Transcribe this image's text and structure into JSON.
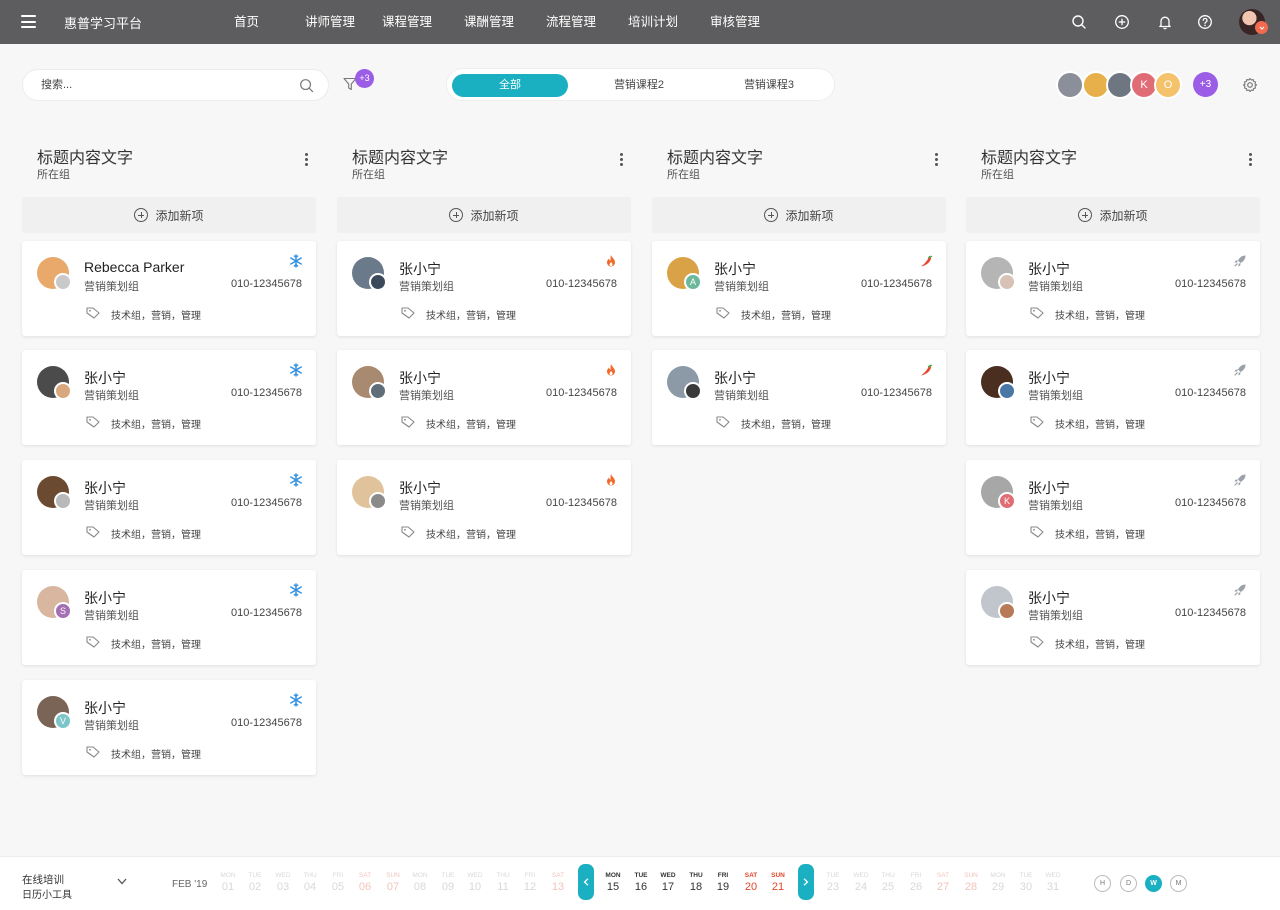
{
  "brand": "惠普学习平台",
  "nav": {
    "tabs": [
      {
        "label": "首页",
        "active": true
      },
      {
        "label": "讲师管理",
        "active": false
      },
      {
        "label": "课程管理",
        "active": false
      },
      {
        "label": "课酬管理",
        "active": false
      },
      {
        "label": "流程管理",
        "active": false
      },
      {
        "label": "培训计划",
        "active": false
      },
      {
        "label": "审核管理",
        "active": false
      }
    ],
    "icons": [
      "search-icon",
      "add-circle-icon",
      "bell-icon",
      "help-icon"
    ]
  },
  "toolbar": {
    "search_placeholder": "搜索...",
    "filter_count": "+3",
    "segments": [
      {
        "label": "全部",
        "active": true
      },
      {
        "label": "营销课程2",
        "active": false
      },
      {
        "label": "营销课程3",
        "active": false
      }
    ],
    "members": [
      {
        "initial": "",
        "color": "#8b8f99"
      },
      {
        "initial": "",
        "color": "#e7b04a"
      },
      {
        "initial": "",
        "color": "#6e7682"
      },
      {
        "initial": "K",
        "color": "#e06c75"
      },
      {
        "initial": "O",
        "color": "#f3c26b"
      }
    ],
    "more_members": "+3"
  },
  "columns": [
    {
      "title": "标题内容文字",
      "subtitle": "所在组",
      "add_label": "添加新项",
      "priority_icon": "snowflake-icon",
      "cards": [
        {
          "name": "Rebecca Parker",
          "group": "营销策划组",
          "phone": "010-12345678",
          "tags": "技术组，营销，管理",
          "initial": "",
          "av_color": "#e8a96b",
          "av2_color": "#c9c9c9"
        },
        {
          "name": "张小宁",
          "group": "营销策划组",
          "phone": "010-12345678",
          "tags": "技术组，营销，管理",
          "initial": "",
          "av_color": "#4b4b4b",
          "av2_color": "#d9a77c"
        },
        {
          "name": "张小宁",
          "group": "营销策划组",
          "phone": "010-12345678",
          "tags": "技术组，营销，管理",
          "initial": "",
          "av_color": "#6a4a30",
          "av2_color": "#b9b9b9"
        },
        {
          "name": "张小宁",
          "group": "营销策划组",
          "phone": "010-12345678",
          "tags": "技术组，营销，管理",
          "initial": "S",
          "av_color": "#d9b6a0",
          "av2_color": "#a56fb3"
        },
        {
          "name": "张小宁",
          "group": "营销策划组",
          "phone": "010-12345678",
          "tags": "技术组，营销，管理",
          "initial": "V",
          "av_color": "#7a6455",
          "av2_color": "#7cc6c9"
        }
      ]
    },
    {
      "title": "标题内容文字",
      "subtitle": "所在组",
      "add_label": "添加新项",
      "priority_icon": "flame-icon",
      "cards": [
        {
          "name": "张小宁",
          "group": "营销策划组",
          "phone": "010-12345678",
          "tags": "技术组，营销，管理",
          "initial": "",
          "av_color": "#6b7a8a",
          "av2_color": "#3b4a5a"
        },
        {
          "name": "张小宁",
          "group": "营销策划组",
          "phone": "010-12345678",
          "tags": "技术组，营销，管理",
          "initial": "",
          "av_color": "#a88a70",
          "av2_color": "#606e7a"
        },
        {
          "name": "张小宁",
          "group": "营销策划组",
          "phone": "010-12345678",
          "tags": "技术组，营销，管理",
          "initial": "",
          "av_color": "#e0c39a",
          "av2_color": "#8a8a8a"
        }
      ]
    },
    {
      "title": "标题内容文字",
      "subtitle": "所在组",
      "add_label": "添加新项",
      "priority_icon": "chili-icon",
      "cards": [
        {
          "name": "张小宁",
          "group": "营销策划组",
          "phone": "010-12345678",
          "tags": "技术组，营销，管理",
          "initial": "A",
          "av_color": "#d9a247",
          "av2_color": "#6bb89a"
        },
        {
          "name": "张小宁",
          "group": "营销策划组",
          "phone": "010-12345678",
          "tags": "技术组，营销，管理",
          "initial": "",
          "av_color": "#8c9aa8",
          "av2_color": "#3a3a3a"
        }
      ]
    },
    {
      "title": "标题内容文字",
      "subtitle": "所在组",
      "add_label": "添加新项",
      "priority_icon": "rocket-icon",
      "cards": [
        {
          "name": "张小宁",
          "group": "营销策划组",
          "phone": "010-12345678",
          "tags": "技术组，营销，管理",
          "initial": "",
          "av_color": "#b5b5b5",
          "av2_color": "#d7c2b5"
        },
        {
          "name": "张小宁",
          "group": "营销策划组",
          "phone": "010-12345678",
          "tags": "技术组，营销，管理",
          "initial": "",
          "av_color": "#4a2e20",
          "av2_color": "#4a77a6"
        },
        {
          "name": "张小宁",
          "group": "营销策划组",
          "phone": "010-12345678",
          "tags": "技术组，营销，管理",
          "initial": "K",
          "av_color": "#a7a7a7",
          "av2_color": "#e06c75"
        },
        {
          "name": "张小宁",
          "group": "营销策划组",
          "phone": "010-12345678",
          "tags": "技术组，营销，管理",
          "initial": "",
          "av_color": "#c0c6cc",
          "av2_color": "#b97a5a"
        }
      ]
    }
  ],
  "bottom": {
    "line1": "在线培训",
    "line2": "日历小工具",
    "month": "FEB '19",
    "days": [
      {
        "dn": "MON",
        "dd": "01",
        "state": "faded",
        "weekend": false
      },
      {
        "dn": "TUE",
        "dd": "02",
        "state": "faded",
        "weekend": false
      },
      {
        "dn": "WED",
        "dd": "03",
        "state": "faded",
        "weekend": false
      },
      {
        "dn": "THU",
        "dd": "04",
        "state": "faded",
        "weekend": false
      },
      {
        "dn": "FRI",
        "dd": "05",
        "state": "faded",
        "weekend": false
      },
      {
        "dn": "SAT",
        "dd": "06",
        "state": "faded",
        "weekend": true
      },
      {
        "dn": "SUN",
        "dd": "07",
        "state": "faded",
        "weekend": true
      },
      {
        "dn": "MON",
        "dd": "08",
        "state": "faded",
        "weekend": false
      },
      {
        "dn": "TUE",
        "dd": "09",
        "state": "faded",
        "weekend": false
      },
      {
        "dn": "WED",
        "dd": "10",
        "state": "faded",
        "weekend": false
      },
      {
        "dn": "THU",
        "dd": "11",
        "state": "faded",
        "weekend": false
      },
      {
        "dn": "FRI",
        "dd": "12",
        "state": "faded",
        "weekend": false
      },
      {
        "dn": "SAT",
        "dd": "13",
        "state": "faded",
        "weekend": true
      },
      {
        "dn": "MON",
        "dd": "15",
        "state": "cur",
        "weekend": false
      },
      {
        "dn": "TUE",
        "dd": "16",
        "state": "cur",
        "weekend": false
      },
      {
        "dn": "WED",
        "dd": "17",
        "state": "cur",
        "weekend": false
      },
      {
        "dn": "THU",
        "dd": "18",
        "state": "cur",
        "weekend": false
      },
      {
        "dn": "FRI",
        "dd": "19",
        "state": "cur",
        "weekend": false
      },
      {
        "dn": "SAT",
        "dd": "20",
        "state": "cur",
        "weekend": true
      },
      {
        "dn": "SUN",
        "dd": "21",
        "state": "cur",
        "weekend": true
      },
      {
        "dn": "TUE",
        "dd": "23",
        "state": "faded",
        "weekend": false
      },
      {
        "dn": "WED",
        "dd": "24",
        "state": "faded",
        "weekend": false
      },
      {
        "dn": "THU",
        "dd": "25",
        "state": "faded",
        "weekend": false
      },
      {
        "dn": "FRI",
        "dd": "26",
        "state": "faded",
        "weekend": false
      },
      {
        "dn": "SAT",
        "dd": "27",
        "state": "faded",
        "weekend": true
      },
      {
        "dn": "SUN",
        "dd": "28",
        "state": "faded",
        "weekend": true
      },
      {
        "dn": "MON",
        "dd": "29",
        "state": "faded",
        "weekend": false
      },
      {
        "dn": "TUE",
        "dd": "30",
        "state": "faded",
        "weekend": false
      },
      {
        "dn": "WED",
        "dd": "31",
        "state": "faded",
        "weekend": false
      }
    ],
    "views": [
      {
        "label": "H",
        "active": false
      },
      {
        "label": "D",
        "active": false
      },
      {
        "label": "W",
        "active": true
      },
      {
        "label": "M",
        "active": false
      }
    ]
  },
  "colors": {
    "accent": "#1ab0c2",
    "badge": "#9b5de5",
    "topbar": "#5d5d5f",
    "snowflake": "#2f8fe0",
    "flame": "#f06a2c",
    "chili": "#e8452c",
    "rocket": "#9aa1a8"
  }
}
